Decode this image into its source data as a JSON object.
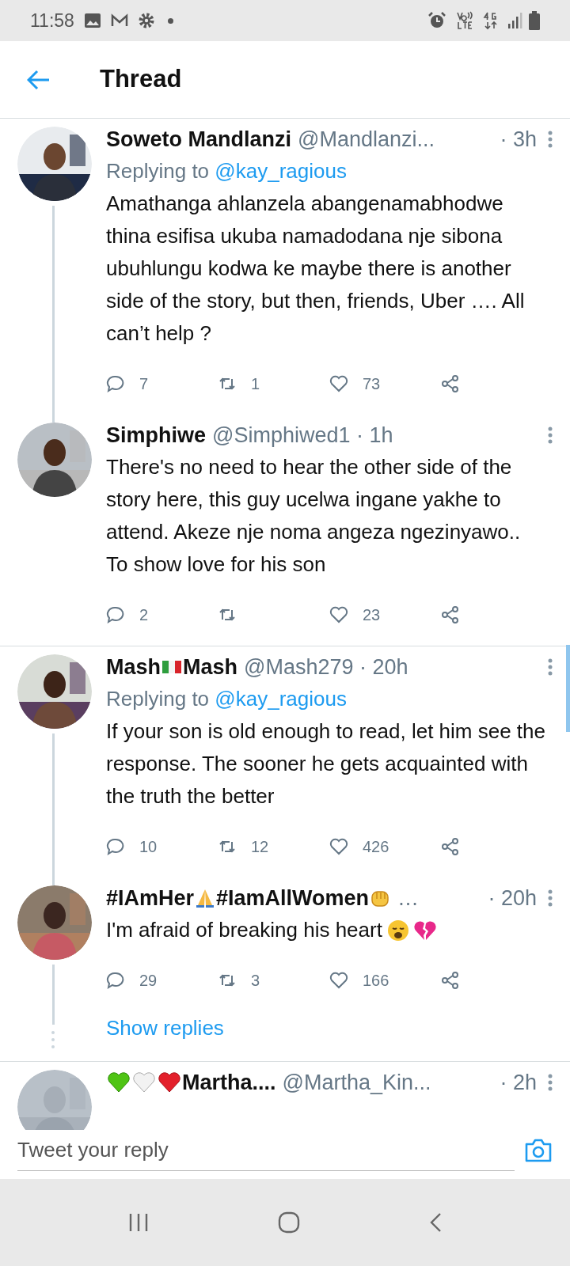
{
  "status_bar": {
    "time": "11:58"
  },
  "header": {
    "title": "Thread"
  },
  "tweets": [
    {
      "name_parts": [
        {
          "kind": "text",
          "text": "Soweto Mandlanzi"
        }
      ],
      "handle": "@Mandlanzi...",
      "time": "· 3h",
      "replying_to": {
        "prefix": "Replying to",
        "user": "@kay_ragious"
      },
      "text_parts": [
        {
          "kind": "text",
          "text": "Amathanga ahlanzela abangenamabhodwe thina esifisa ukuba namadodana nje sibona ubuhlungu kodwa ke maybe there is another side of the story, but then, friends, Uber …. All can’t help ?"
        }
      ],
      "replies": "7",
      "retweets": "1",
      "likes": "73",
      "thread_line": true,
      "divider": false
    },
    {
      "name_parts": [
        {
          "kind": "text",
          "text": "Simphiwe"
        }
      ],
      "handle": "@Simphiwed1 · 1h",
      "text_parts": [
        {
          "kind": "text",
          "text": "There's no need to hear the other side of the story here, this guy ucelwa ingane yakhe to attend. Akeze nje noma angeza ngezinyawo.. To show love for his son"
        }
      ],
      "replies": "2",
      "likes": "23",
      "thread_line": false,
      "divider": true
    },
    {
      "name_parts": [
        {
          "kind": "text",
          "text": "Mash"
        },
        {
          "kind": "flag"
        },
        {
          "kind": "text",
          "text": "Mash"
        }
      ],
      "handle": "@Mash279 · 20h",
      "replying_to": {
        "prefix": "Replying to",
        "user": "@kay_ragious"
      },
      "text_parts": [
        {
          "kind": "text",
          "text": "If your son is old enough to read, let him see the response. The sooner he gets acquainted with the truth the better"
        }
      ],
      "replies": "10",
      "retweets": "12",
      "likes": "426",
      "thread_line": true,
      "divider": false
    },
    {
      "name_parts": [
        {
          "kind": "text",
          "text": "#IAmHer"
        },
        {
          "kind": "hands"
        },
        {
          "kind": "text",
          "text": "#IamAllWomen"
        },
        {
          "kind": "fist"
        }
      ],
      "handle": "…",
      "time": "· 20h",
      "text_parts": [
        {
          "kind": "text",
          "text": "I'm afraid of breaking his heart"
        },
        {
          "kind": "sad"
        },
        {
          "kind": "broken_heart"
        }
      ],
      "replies": "29",
      "retweets": "3",
      "likes": "166",
      "thread_line": true,
      "show_replies": "Show replies",
      "divider": true
    },
    {
      "name_parts": [
        {
          "kind": "green_heart"
        },
        {
          "kind": "white_heart"
        },
        {
          "kind": "red_heart"
        },
        {
          "kind": "text",
          "text": "Martha...."
        }
      ],
      "handle": "@Martha_Kin...",
      "time": "· 2h",
      "thread_line": false,
      "divider": false
    }
  ],
  "reply_bar": {
    "placeholder": "Tweet your reply"
  }
}
